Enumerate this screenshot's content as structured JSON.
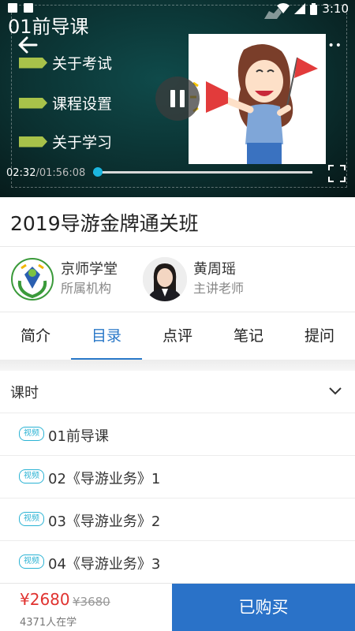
{
  "status_bar": {
    "time": "3:10"
  },
  "player": {
    "title": "01前导课",
    "menu": [
      "关于考试",
      "课程设置",
      "关于学习"
    ],
    "current_time": "02:32",
    "separator": "/",
    "total_time": "01:56:08",
    "progress_fraction": 0.02,
    "school_logo_en": "Tianma Tourism Training School"
  },
  "course": {
    "title": "2019导游金牌通关班"
  },
  "organization": {
    "name": "京师学堂",
    "role": "所属机构"
  },
  "teacher": {
    "name": "黄周瑶",
    "role": "主讲老师"
  },
  "tabs": [
    {
      "label": "简介"
    },
    {
      "label": "目录",
      "active": true
    },
    {
      "label": "点评"
    },
    {
      "label": "笔记"
    },
    {
      "label": "提问"
    }
  ],
  "lessons_section": {
    "label": "课时"
  },
  "lessons": [
    {
      "badge": "视频",
      "title": "01前导课"
    },
    {
      "badge": "视频",
      "title": "02《导游业务》1"
    },
    {
      "badge": "视频",
      "title": "03《导游业务》2"
    },
    {
      "badge": "视频",
      "title": "04《导游业务》3"
    }
  ],
  "purchase": {
    "price": "¥2680",
    "original_price": "¥3680",
    "learners": "4371人在学",
    "button_label": "已购买"
  },
  "colors": {
    "accent": "#2a78c8",
    "price": "#e0322f",
    "buy_button": "#2a72c8",
    "badge": "#2bb3d4"
  }
}
